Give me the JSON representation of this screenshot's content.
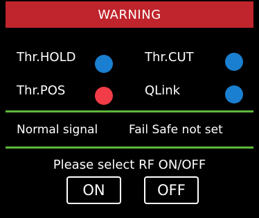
{
  "header": {
    "title": "WARNING",
    "color": "#c0242c"
  },
  "status": {
    "items": [
      {
        "label": "Thr.HOLD",
        "indicator_color": "#1a7fd0",
        "indicator_icon": "status-dot"
      },
      {
        "label": "Thr.CUT",
        "indicator_color": "#1a7fd0",
        "indicator_icon": "status-dot"
      },
      {
        "label": "Thr.POS",
        "indicator_color": "#f23c47",
        "indicator_icon": "status-dot"
      },
      {
        "label": "QLink",
        "indicator_color": "#1a7fd0",
        "indicator_icon": "status-dot"
      }
    ]
  },
  "info": {
    "signal": "Normal signal",
    "failsafe": "Fail Safe not set"
  },
  "rf": {
    "prompt": "Please select RF ON/OFF",
    "on_label": "ON",
    "off_label": "OFF"
  },
  "colors": {
    "background": "#000000",
    "divider": "#5fb83a",
    "text": "#ffffff"
  }
}
